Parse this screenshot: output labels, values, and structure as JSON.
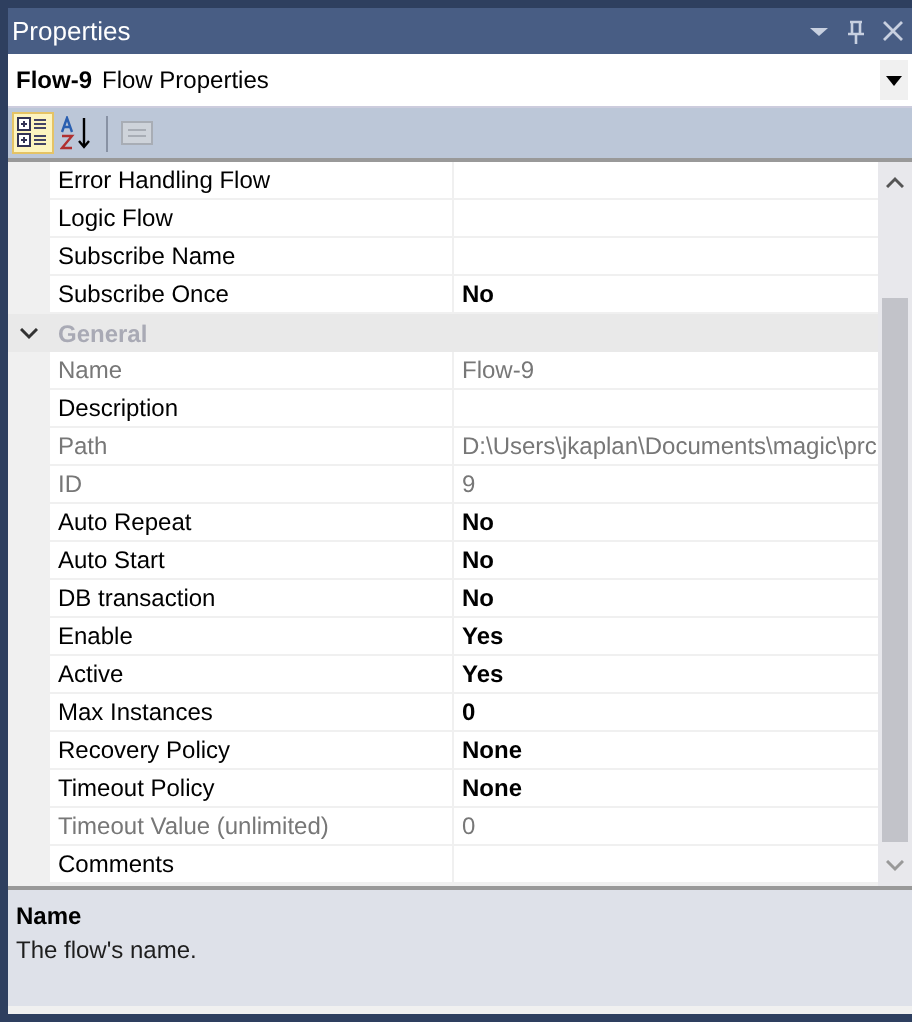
{
  "window": {
    "title": "Properties"
  },
  "object_selector": {
    "name": "Flow-9",
    "type": "Flow Properties"
  },
  "toolbar": [
    {
      "kind": "categorized",
      "selected": true,
      "disabled": false
    },
    {
      "kind": "alphabetical",
      "selected": false,
      "disabled": false
    },
    {
      "kind": "pages",
      "selected": false,
      "disabled": true
    }
  ],
  "grid": [
    {
      "kind": "property",
      "name": "Error Handling Flow",
      "readonly": false,
      "modified": false
    },
    {
      "kind": "property",
      "name": "Logic Flow",
      "readonly": false,
      "modified": false
    },
    {
      "kind": "property",
      "name": "Subscribe Name",
      "readonly": false,
      "modified": false
    },
    {
      "kind": "property",
      "name": "Subscribe Once",
      "value": "No",
      "readonly": false,
      "modified": true
    },
    {
      "kind": "category",
      "name": "General",
      "expanded": true
    },
    {
      "kind": "property",
      "name": "Name",
      "value": "Flow-9",
      "readonly": true,
      "modified": false
    },
    {
      "kind": "property",
      "name": "Description",
      "readonly": false,
      "modified": false
    },
    {
      "kind": "property",
      "name": "Path",
      "value": "D:\\Users\\jkaplan\\Documents\\magic\\prc",
      "readonly": true,
      "modified": false
    },
    {
      "kind": "property",
      "name": "ID",
      "value": "9",
      "readonly": true,
      "modified": false
    },
    {
      "kind": "property",
      "name": "Auto Repeat",
      "value": "No",
      "readonly": false,
      "modified": true
    },
    {
      "kind": "property",
      "name": "Auto Start",
      "value": "No",
      "readonly": false,
      "modified": true
    },
    {
      "kind": "property",
      "name": "DB transaction",
      "value": "No",
      "readonly": false,
      "modified": true
    },
    {
      "kind": "property",
      "name": "Enable",
      "value": "Yes",
      "readonly": false,
      "modified": true
    },
    {
      "kind": "property",
      "name": "Active",
      "value": "Yes",
      "readonly": false,
      "modified": true
    },
    {
      "kind": "property",
      "name": "Max Instances",
      "value": "0",
      "readonly": false,
      "modified": true
    },
    {
      "kind": "property",
      "name": "Recovery Policy",
      "value": "None",
      "readonly": false,
      "modified": true
    },
    {
      "kind": "property",
      "name": "Timeout Policy",
      "value": "None",
      "readonly": false,
      "modified": true
    },
    {
      "kind": "property",
      "name": "Timeout Value (unlimited)",
      "value": "0",
      "readonly": true,
      "modified": false
    },
    {
      "kind": "property",
      "name": "Comments",
      "readonly": false,
      "modified": false
    }
  ],
  "description": {
    "title": "Name",
    "text": "The flow's name."
  }
}
